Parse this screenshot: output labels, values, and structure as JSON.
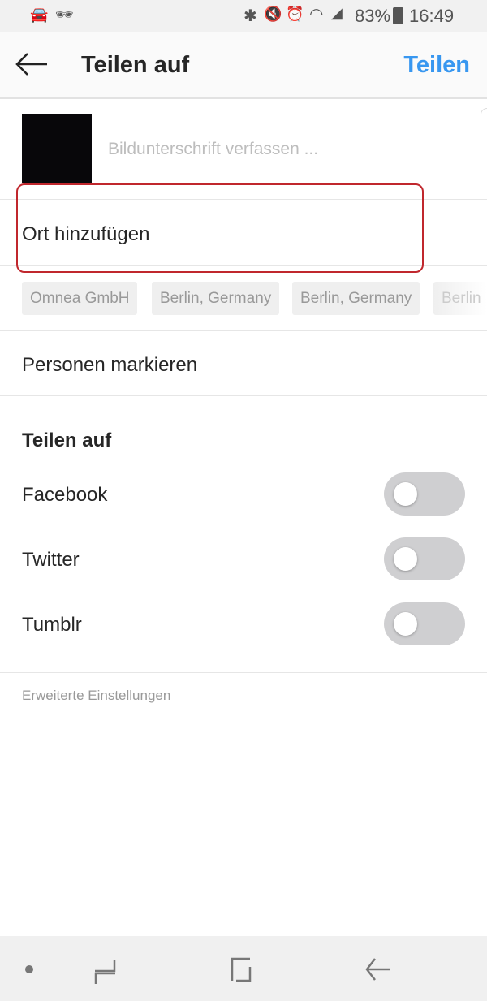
{
  "status_bar": {
    "battery": "83%",
    "time": "16:49",
    "icons": [
      "car-icon",
      "incognito-icon",
      "bluetooth-icon",
      "mute-icon",
      "alarm-icon",
      "wifi-icon",
      "signal-icon",
      "battery-charging-icon"
    ]
  },
  "header": {
    "title": "Teilen auf",
    "share_label": "Teilen",
    "accent": "#3897f0"
  },
  "caption": {
    "placeholder": "Bildunterschrift verfassen ..."
  },
  "location": {
    "label": "Ort hinzufügen",
    "highlight_color": "#c0272d",
    "suggestions": [
      "Omnea GmbH",
      "Berlin, Germany",
      "Berlin, Germany",
      "Berlin"
    ]
  },
  "tag_people": {
    "label": "Personen markieren"
  },
  "share_section": {
    "title": "Teilen auf",
    "items": [
      {
        "label": "Facebook",
        "on": false
      },
      {
        "label": "Twitter",
        "on": false
      },
      {
        "label": "Tumblr",
        "on": false
      }
    ]
  },
  "advanced": {
    "label": "Erweiterte Einstellungen"
  },
  "nav_bar": {
    "icons": [
      "dot-icon",
      "recents-icon",
      "home-icon",
      "back-icon"
    ]
  }
}
